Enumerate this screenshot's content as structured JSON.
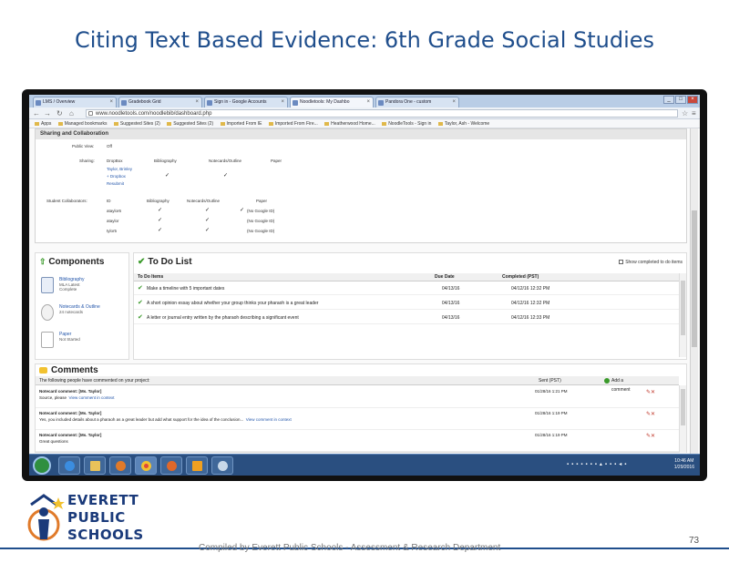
{
  "slide": {
    "title": "Citing Text Based Evidence: 6th Grade Social Studies",
    "footer": "Compiled by Everett Public Schools - Assessment & Research Department",
    "page_number": "73",
    "logo": {
      "line1": "EVERETT",
      "line2": "PUBLIC",
      "line3": "SCHOOLS"
    }
  },
  "browser": {
    "tabs": [
      {
        "label": "LMS / Overview"
      },
      {
        "label": "Gradebook Grid"
      },
      {
        "label": "Sign in - Google Accounts"
      },
      {
        "label": "Noodletools: My Dashbo"
      },
      {
        "label": "Pandora One - custom"
      }
    ],
    "active_tab": 3,
    "url": "www.noodletools.com/noodlebib/dashboard.php",
    "bookmarks": [
      "Apps",
      "Managed bookmarks",
      "Suggested Sites (2)",
      "Suggested Sites (2)",
      "Imported From IE",
      "Imported From Fire...",
      "Heatherwood Home...",
      "NoodleTools - Sign in",
      "Taylor, Ash - Welcome"
    ]
  },
  "sharing": {
    "header": "Sharing and Collaboration",
    "public_view_label": "Public View:",
    "public_view_value": "Off",
    "sharing_label": "Sharing:",
    "sharing_headers": [
      "DropBox",
      "Bibliography",
      "Notecards/Outline",
      "Paper"
    ],
    "sharing_teacher": "Taylor, Brinley",
    "sharing_subtext": "+ Dropbox",
    "sharing_link": "Resubmit",
    "collab_label": "Student Collaborators:",
    "collab_headers": [
      "ID",
      "Bibliography",
      "Notecards/Outline",
      "Paper"
    ],
    "collab_rows": [
      {
        "id": "ataylor6",
        "paper": "(No Google ID)"
      },
      {
        "id": "ataylor",
        "paper": "(No Google ID)"
      },
      {
        "id": "tylor5",
        "paper": "(No Google ID)"
      }
    ]
  },
  "components": {
    "title": "Components",
    "items": [
      {
        "title": "Bibliography",
        "sub": "MLA Latest\nComplete",
        "icon": "bibliography-icon"
      },
      {
        "title": "Notecards & Outline",
        "sub": "24 notecards",
        "icon": "notecards-icon"
      },
      {
        "title": "Paper",
        "sub": "Not Started",
        "icon": "paper-icon"
      }
    ]
  },
  "todo": {
    "title": "To Do List",
    "show_completed": "Show completed to do items",
    "headers": {
      "item": "To Do Items",
      "due": "Due Date",
      "completed": "Completed (PST)"
    },
    "rows": [
      {
        "item": "Make a timeline with 5 important dates",
        "due": "04/13/16",
        "completed": "04/12/16 12:32 PM"
      },
      {
        "item": "A short opinion essay about whether your group thinks your pharaoh is a great leader",
        "due": "04/13/16",
        "completed": "04/12/16 12:32 PM"
      },
      {
        "item": "A letter or journal entry written by the pharaoh describing a significant event",
        "due": "04/13/16",
        "completed": "04/12/16 12:33 PM"
      }
    ]
  },
  "comments": {
    "title": "Comments",
    "intro": "The following people have commented on your project:",
    "date_header": "Sent (PST)",
    "add_label": "Add a comment",
    "rows": [
      {
        "who": "Notecard comment: [Ms. Taylor]",
        "msg": "Source, please",
        "link": "View comment in context",
        "date": "01/28/16 1:21 PM"
      },
      {
        "who": "Notecard comment: [Ms. Taylor]",
        "msg": "Yes, you included details about a pharaoh as a great leader but add what support for the idea of the conclusion...",
        "link": "View comment in context",
        "date": "01/28/16 1:19 PM"
      },
      {
        "who": "Notecard comment: [Ms. Taylor]",
        "msg": "Great questions",
        "link": "",
        "date": "01/28/16 1:19 PM"
      }
    ]
  },
  "taskbar": {
    "apps": [
      "ie-icon",
      "explorer-folder-icon",
      "media-player-icon",
      "chrome-icon",
      "firefox-icon",
      "outlook-icon",
      "paint-icon"
    ],
    "time": "10:46 AM",
    "date": "1/29/2016"
  },
  "colors": {
    "title_blue": "#1f4e8c",
    "taskbar": "#2a4f80",
    "check_green": "#3a9a2a"
  }
}
